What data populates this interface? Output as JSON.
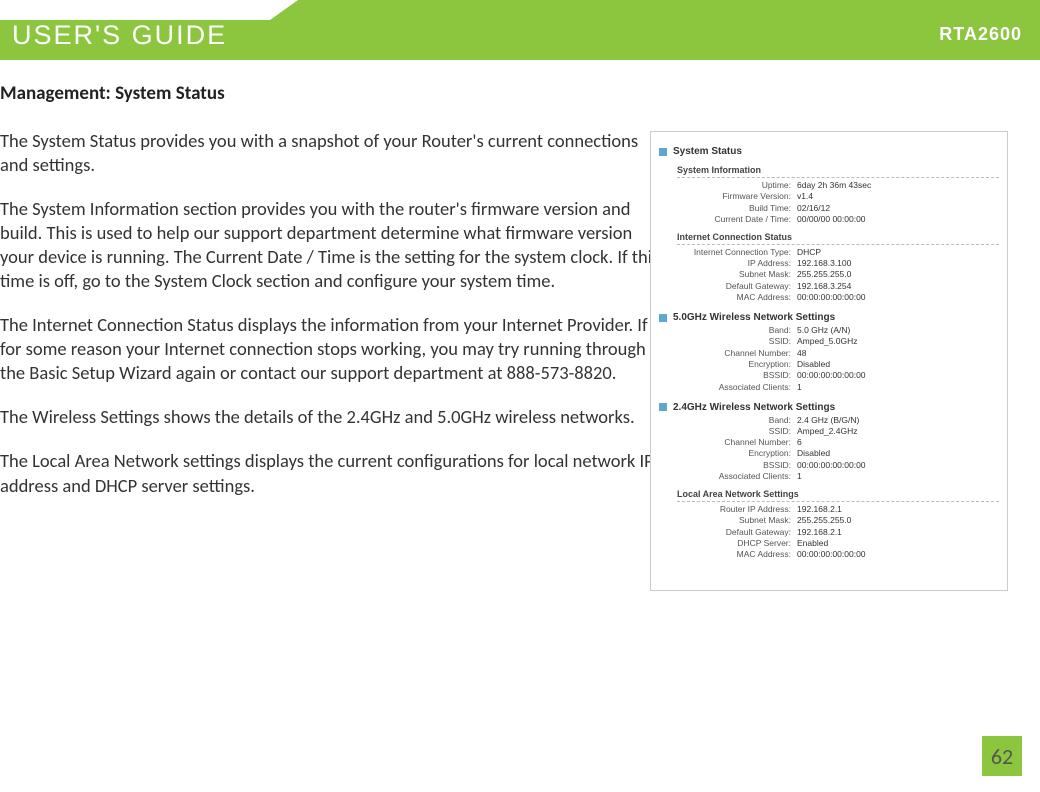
{
  "header": {
    "title": "USER'S GUIDE",
    "model": "RTA2600"
  },
  "section_title": "Management: System Status",
  "paras": [
    "The System Status provides you with a snapshot of your Router's current connections and settings.",
    "The System Information section provides you with the router's firmware version and build.  This is used to help our support department determine what firmware version your device is running.  The Current Date / Time is the setting for the system clock.  If this time is off, go to the System Clock section and configure your system time.",
    "The Internet Connection Status displays the information from your Internet Provider.  If for some reason your Internet connection stops working, you may try running through the Basic Setup Wizard again or contact our support department at 888-573-8820.",
    "The Wireless Settings shows the details of the 2.4GHz and 5.0GHz wireless networks.",
    "The Local Area Network settings displays the current configurations for local network IP address and DHCP server settings."
  ],
  "ss": {
    "main": "System Status",
    "g1": {
      "h": "System Information",
      "r": [
        [
          "Uptime",
          "6day 2h 36m 43sec"
        ],
        [
          "Firmware Version",
          "v1.4"
        ],
        [
          "Build Time",
          "02/16/12"
        ],
        [
          "Current Date / Time",
          "00/00/00 00:00:00"
        ]
      ]
    },
    "g2": {
      "h": "Internet Connection Status",
      "r": [
        [
          "Internet Connection Type",
          "DHCP"
        ],
        [
          "IP Address",
          "192.168.3.100"
        ],
        [
          "Subnet Mask",
          "255.255.255.0"
        ],
        [
          "Default Gateway",
          "192.168.3.254"
        ],
        [
          "MAC Address",
          "00:00:00:00:00:00"
        ]
      ]
    },
    "g3": {
      "h": "5.0GHz Wireless Network Settings",
      "r": [
        [
          "Band",
          "5.0 GHz (A/N)"
        ],
        [
          "SSID",
          "Amped_5.0GHz"
        ],
        [
          "Channel Number",
          "48"
        ],
        [
          "Encryption",
          "Disabled"
        ],
        [
          "BSSID",
          "00:00:00:00:00:00"
        ],
        [
          "Associated Clients",
          "1"
        ]
      ]
    },
    "g4": {
      "h": "2.4GHz Wireless Network Settings",
      "r": [
        [
          "Band",
          "2.4 GHz (B/G/N)"
        ],
        [
          "SSID",
          "Amped_2.4GHz"
        ],
        [
          "Channel Number",
          "6"
        ],
        [
          "Encryption",
          "Disabled"
        ],
        [
          "BSSID",
          "00:00:00:00:00:00"
        ],
        [
          "Associated Clients",
          "1"
        ]
      ]
    },
    "g5": {
      "h": "Local Area Network Settings",
      "r": [
        [
          "Router IP Address",
          "192.168.2.1"
        ],
        [
          "Subnet Mask",
          "255.255.255.0"
        ],
        [
          "Default Gateway",
          "192.168.2.1"
        ],
        [
          "DHCP Server",
          "Enabled"
        ],
        [
          "MAC Address",
          "00:00:00:00:00:00"
        ]
      ]
    }
  },
  "page": "62"
}
